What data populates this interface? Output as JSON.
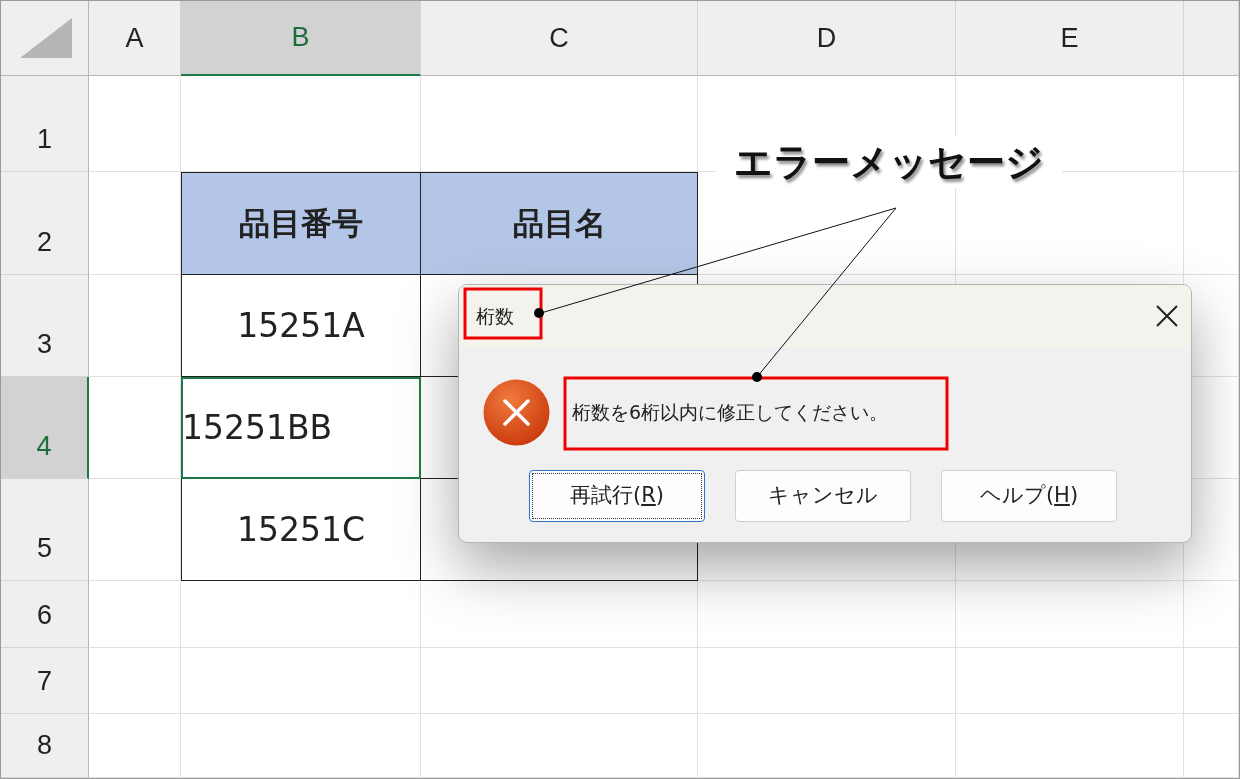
{
  "sheet": {
    "columns": [
      {
        "label": "A",
        "selected": false
      },
      {
        "label": "B",
        "selected": true
      },
      {
        "label": "C",
        "selected": false
      },
      {
        "label": "D",
        "selected": false
      },
      {
        "label": "E",
        "selected": false
      }
    ],
    "rows": [
      {
        "label": "1",
        "selected": false
      },
      {
        "label": "2",
        "selected": false
      },
      {
        "label": "3",
        "selected": false
      },
      {
        "label": "4",
        "selected": true
      },
      {
        "label": "5",
        "selected": false
      },
      {
        "label": "6",
        "selected": false
      },
      {
        "label": "7",
        "selected": false
      },
      {
        "label": "8",
        "selected": false
      }
    ]
  },
  "table": {
    "columns": [
      {
        "label": "品目番号"
      },
      {
        "label": "品目名"
      }
    ],
    "rows": [
      {
        "item_number": "15251A",
        "selected": false
      },
      {
        "item_number": "15251BB",
        "selected": true
      },
      {
        "item_number": "15251C",
        "selected": false
      }
    ]
  },
  "dialog": {
    "title": "桁数",
    "message": "桁数を6桁以内に修正してください。",
    "buttons": [
      {
        "label_before": "再試行(",
        "access_key": "R",
        "label_after": ")",
        "focused": true
      },
      {
        "label_before": "キャンセル",
        "focused": false
      },
      {
        "label_before": "ヘルプ(",
        "access_key": "H",
        "label_after": ")",
        "focused": false
      }
    ]
  },
  "annotation": {
    "callout": "エラーメッセージ"
  }
}
